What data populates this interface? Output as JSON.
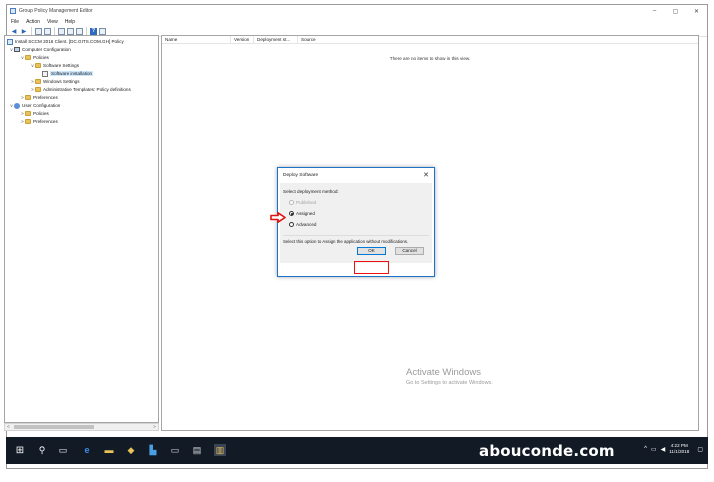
{
  "window": {
    "title": "Group Policy Management Editor",
    "controls": [
      "–",
      "▢",
      "✕"
    ]
  },
  "menu": [
    "File",
    "Action",
    "View",
    "Help"
  ],
  "tree": {
    "items": [
      {
        "label": "Install SCCM 2016 Client. [DC.GITS.COM.GH] Policy",
        "icon": "gpo-icon",
        "chevron": ""
      },
      {
        "label": "Computer Configuration",
        "icon": "computer-icon",
        "chevron": "v"
      },
      {
        "label": "Policies",
        "icon": "folder-icon",
        "chevron": "v"
      },
      {
        "label": "Software Settings",
        "icon": "folder-icon",
        "chevron": "v"
      },
      {
        "label": "Software installation",
        "icon": "package-icon",
        "chevron": "",
        "selected": true
      },
      {
        "label": "Windows Settings",
        "icon": "folder-icon",
        "chevron": ">"
      },
      {
        "label": "Administrative Templates: Policy definitions",
        "icon": "folder-icon",
        "chevron": ">"
      },
      {
        "label": "Preferences",
        "icon": "folder-icon",
        "chevron": ">"
      },
      {
        "label": "User Configuration",
        "icon": "user-icon",
        "chevron": "v"
      },
      {
        "label": "Policies",
        "icon": "folder-icon",
        "chevron": ">"
      },
      {
        "label": "Preferences",
        "icon": "folder-icon",
        "chevron": ">"
      }
    ]
  },
  "list": {
    "columns": [
      "Name",
      "Version",
      "Deployment st...",
      "Source"
    ],
    "empty_message": "There are no items to show in this view."
  },
  "activation": {
    "line1": "Activate Windows",
    "line2": "Go to Settings to activate Windows."
  },
  "dialog": {
    "title": "Deploy Software",
    "close": "✕",
    "prompt": "Select deployment method:",
    "options": [
      {
        "label": "Published",
        "state": "disabled"
      },
      {
        "label": "Assigned",
        "state": "checked"
      },
      {
        "label": "Advanced",
        "state": "unchecked"
      }
    ],
    "description": "Select this option to Assign the application without modifications.",
    "ok_label": "OK",
    "cancel_label": "Cancel"
  },
  "taskbar": {
    "watermark": "abouconde.com",
    "time": "4:22 PM",
    "date": "11/1/2018"
  },
  "colors": {
    "highlight_red": "#e11111",
    "accent_blue": "#0078d7",
    "taskbar_bg": "#121a26"
  }
}
